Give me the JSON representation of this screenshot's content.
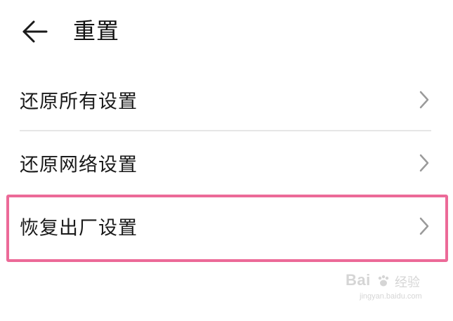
{
  "header": {
    "title": "重置",
    "back_icon": "arrow-left-icon"
  },
  "menu": {
    "items": [
      {
        "label": "还原所有设置",
        "icon": "chevron-right-icon"
      },
      {
        "label": "还原网络设置",
        "icon": "chevron-right-icon"
      },
      {
        "label": "恢复出厂设置",
        "icon": "chevron-right-icon",
        "highlighted": true
      }
    ]
  },
  "colors": {
    "highlight_border": "#ec6a98",
    "text": "#1a1a1a",
    "chevron": "#9a9a9a",
    "divider": "#e6e6e6"
  },
  "watermark": {
    "main": "Bai",
    "cn": "经验",
    "sub": "jingyan.baidu.com"
  }
}
